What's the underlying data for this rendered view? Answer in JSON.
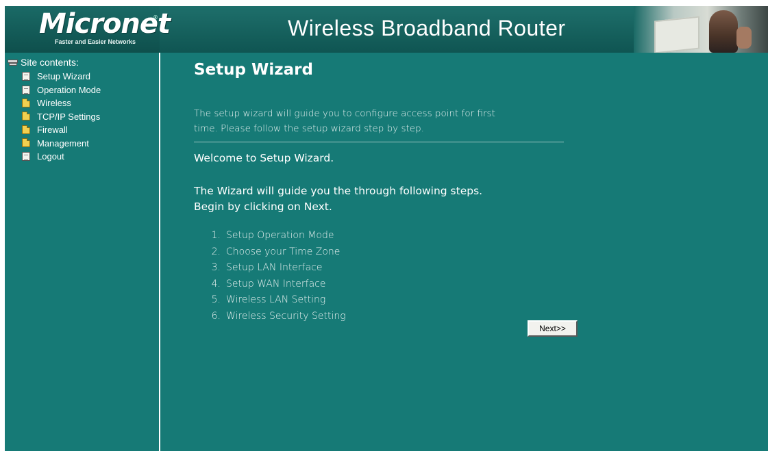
{
  "header": {
    "logo_text": "Micronet",
    "logo_tagline": "Faster and Easier Networks",
    "title": "Wireless Broadband Router"
  },
  "sidebar": {
    "heading": "Site contents:",
    "items": [
      {
        "label": "Setup Wizard",
        "icon": "document-icon"
      },
      {
        "label": "Operation Mode",
        "icon": "document-icon"
      },
      {
        "label": "Wireless",
        "icon": "folder-icon"
      },
      {
        "label": "TCP/IP Settings",
        "icon": "folder-icon"
      },
      {
        "label": "Firewall",
        "icon": "folder-icon"
      },
      {
        "label": "Management",
        "icon": "folder-icon"
      },
      {
        "label": "Logout",
        "icon": "document-icon"
      }
    ]
  },
  "main": {
    "title": "Setup Wizard",
    "intro_line1": "The setup wizard will guide you to configure access point for first",
    "intro_line2": "time. Please follow the setup wizard step by step.",
    "welcome": "Welcome to Setup Wizard.",
    "guide_line1": "The Wizard will guide you the through following steps.",
    "guide_line2": "Begin by clicking on Next.",
    "steps": [
      {
        "num": "1.",
        "label": "Setup Operation Mode"
      },
      {
        "num": "2.",
        "label": "Choose your Time Zone"
      },
      {
        "num": "3.",
        "label": "Setup LAN Interface"
      },
      {
        "num": "4.",
        "label": "Setup WAN Interface"
      },
      {
        "num": "5.",
        "label": "Wireless LAN Setting"
      },
      {
        "num": "6.",
        "label": "Wireless Security Setting"
      }
    ],
    "next_label": "Next>>"
  },
  "colors": {
    "background": "#167a76",
    "banner": "#0f5552",
    "text": "#ffffff",
    "button_face": "#f2f2ee"
  }
}
